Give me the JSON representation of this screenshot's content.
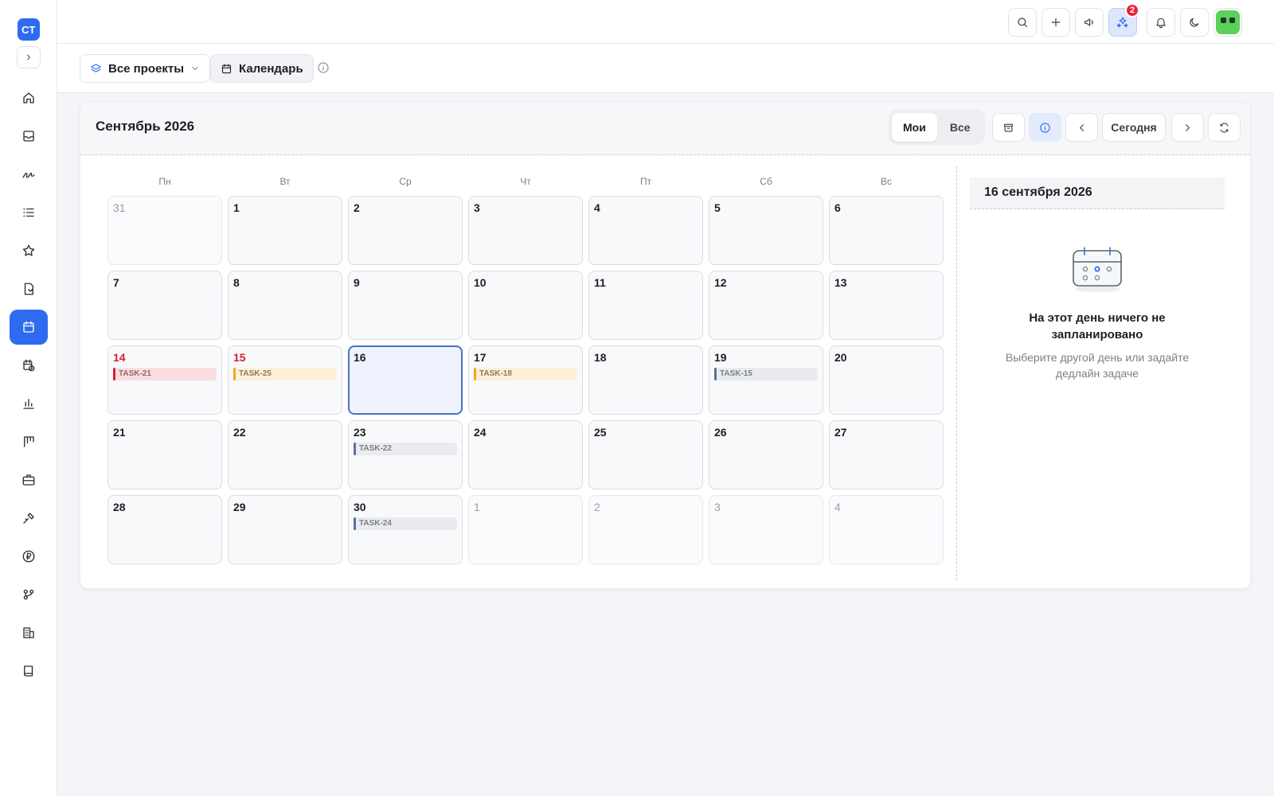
{
  "app": {
    "logo_text": "СТ"
  },
  "sidebar": {
    "items": [
      {
        "icon": "home-icon"
      },
      {
        "icon": "inbox-icon"
      },
      {
        "icon": "signature-icon"
      },
      {
        "icon": "list-icon"
      },
      {
        "icon": "star-icon"
      },
      {
        "icon": "document-icon"
      },
      {
        "icon": "calendar-icon",
        "active": true
      },
      {
        "icon": "calendar-clock-icon"
      },
      {
        "icon": "chart-icon"
      },
      {
        "icon": "kanban-icon"
      },
      {
        "icon": "briefcase-icon"
      },
      {
        "icon": "tools-icon"
      },
      {
        "icon": "ruble-icon"
      },
      {
        "icon": "git-icon"
      },
      {
        "icon": "building-icon"
      },
      {
        "icon": "book-icon"
      }
    ]
  },
  "topbar": {
    "notification_count": "2",
    "icons": [
      "search-icon",
      "plus-icon",
      "megaphone-icon",
      "sparkles-icon",
      "bell-icon",
      "moon-icon",
      "avatar"
    ]
  },
  "filters": {
    "projects_label": "Все проекты",
    "calendar_label": "Календарь"
  },
  "calendar": {
    "title": "Сентябрь 2026",
    "segment_mine": "Мои",
    "segment_all": "Все",
    "today_label": "Сегодня",
    "weekdays": [
      "Пн",
      "Вт",
      "Ср",
      "Чт",
      "Пт",
      "Сб",
      "Вс"
    ],
    "days": [
      {
        "n": "31",
        "muted": true
      },
      {
        "n": "1"
      },
      {
        "n": "2"
      },
      {
        "n": "3"
      },
      {
        "n": "4"
      },
      {
        "n": "5"
      },
      {
        "n": "6"
      },
      {
        "n": "7"
      },
      {
        "n": "8"
      },
      {
        "n": "9"
      },
      {
        "n": "10"
      },
      {
        "n": "11"
      },
      {
        "n": "12"
      },
      {
        "n": "13"
      },
      {
        "n": "14",
        "red": true,
        "task": "TASK-21",
        "color": "red"
      },
      {
        "n": "15",
        "red": true,
        "task": "TASK-25",
        "color": "yellow"
      },
      {
        "n": "16",
        "selected": true
      },
      {
        "n": "17",
        "task": "TASK-18",
        "color": "yellow"
      },
      {
        "n": "18"
      },
      {
        "n": "19",
        "task": "TASK-15",
        "color": "grey"
      },
      {
        "n": "20"
      },
      {
        "n": "21"
      },
      {
        "n": "22"
      },
      {
        "n": "23",
        "task": "TASK-22",
        "color": "grey"
      },
      {
        "n": "24"
      },
      {
        "n": "25"
      },
      {
        "n": "26"
      },
      {
        "n": "27"
      },
      {
        "n": "28"
      },
      {
        "n": "29"
      },
      {
        "n": "30",
        "task": "TASK-24",
        "color": "grey"
      },
      {
        "n": "1",
        "muted": true
      },
      {
        "n": "2",
        "muted": true
      },
      {
        "n": "3",
        "muted": true
      },
      {
        "n": "4",
        "muted": true
      }
    ]
  },
  "side_panel": {
    "date": "16 сентября 2026",
    "empty_title": "На этот день ничего не запланировано",
    "empty_subtitle": "Выберите другой день или задайте дедлайн задаче"
  },
  "colors": {
    "accent": "#2f6bf0",
    "overdue": "#d42030",
    "warning": "#efa91c",
    "badge": "#e5243b"
  }
}
